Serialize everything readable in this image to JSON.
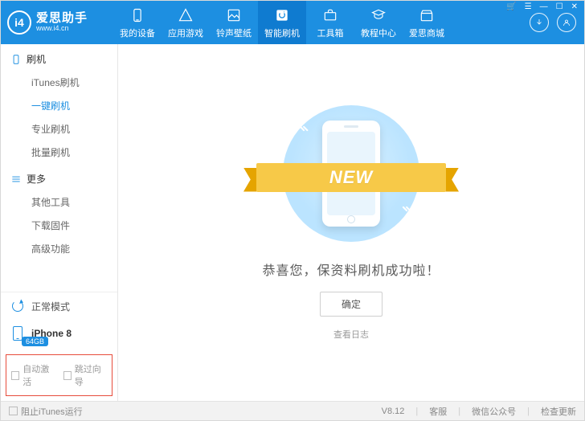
{
  "header": {
    "logo_cn": "爱思助手",
    "logo_url": "www.i4.cn",
    "nav": [
      {
        "label": "我的设备"
      },
      {
        "label": "应用游戏"
      },
      {
        "label": "铃声壁纸"
      },
      {
        "label": "智能刷机"
      },
      {
        "label": "工具箱"
      },
      {
        "label": "教程中心"
      },
      {
        "label": "爱思商城"
      }
    ]
  },
  "sidebar": {
    "group1_title": "刷机",
    "group1_items": [
      "iTunes刷机",
      "一键刷机",
      "专业刷机",
      "批量刷机"
    ],
    "group2_title": "更多",
    "group2_items": [
      "其他工具",
      "下载固件",
      "高级功能"
    ],
    "mode_label": "正常模式",
    "device_name": "iPhone 8",
    "device_storage": "64GB",
    "check_auto_activate": "自动激活",
    "check_skip_guide": "跳过向导"
  },
  "main": {
    "ribbon_text": "NEW",
    "message": "恭喜您，保资料刷机成功啦！",
    "confirm_label": "确定",
    "log_link": "查看日志"
  },
  "footer": {
    "block_itunes": "阻止iTunes运行",
    "version": "V8.12",
    "support": "客服",
    "wechat": "微信公众号",
    "check_update": "检查更新"
  }
}
